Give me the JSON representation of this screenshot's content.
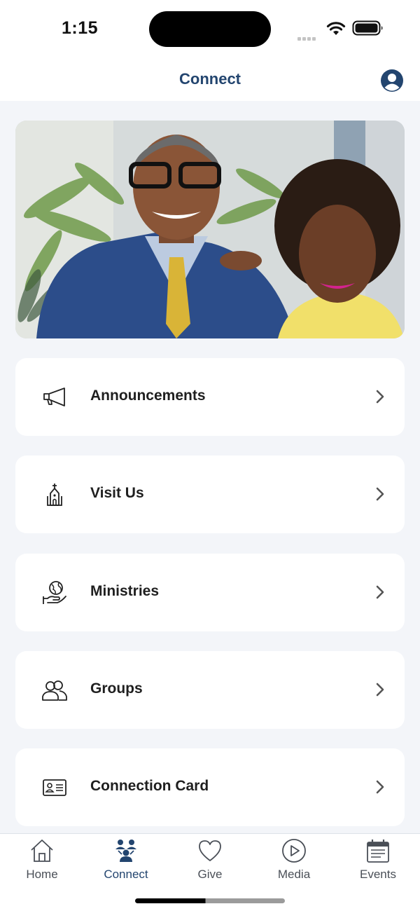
{
  "status_bar": {
    "time": "1:15"
  },
  "header": {
    "title": "Connect"
  },
  "menu": [
    {
      "label": "Announcements",
      "icon": "megaphone-icon"
    },
    {
      "label": "Visit Us",
      "icon": "church-icon"
    },
    {
      "label": "Ministries",
      "icon": "globe-in-hand-icon"
    },
    {
      "label": "Groups",
      "icon": "people-icon"
    },
    {
      "label": "Connection Card",
      "icon": "id-card-icon"
    }
  ],
  "tabs": [
    {
      "label": "Home",
      "icon": "home-icon",
      "active": false
    },
    {
      "label": "Connect",
      "icon": "connect-people-icon",
      "active": true
    },
    {
      "label": "Give",
      "icon": "heart-icon",
      "active": false
    },
    {
      "label": "Media",
      "icon": "play-circle-icon",
      "active": false
    },
    {
      "label": "Events",
      "icon": "calendar-icon",
      "active": false
    }
  ],
  "colors": {
    "accent": "#23456f",
    "background": "#f3f5f9",
    "card": "#ffffff"
  }
}
